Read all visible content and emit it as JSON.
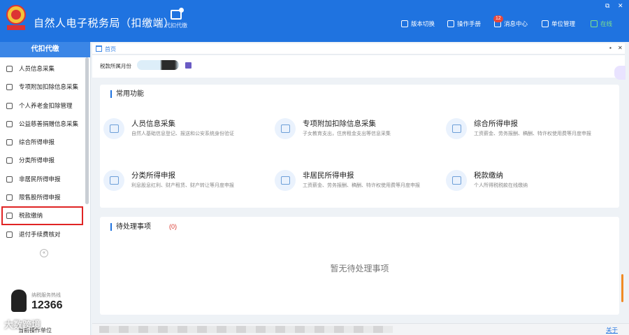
{
  "app": {
    "title": "自然人电子税务局（扣缴端）",
    "emblem_text": "国家税务总局",
    "module_label": "代扣代缴"
  },
  "topmenu": [
    {
      "label": "版本切换",
      "icon": "switch-icon"
    },
    {
      "label": "操作手册",
      "icon": "manual-icon"
    },
    {
      "label": "消息中心",
      "icon": "message-icon",
      "badge": "12"
    },
    {
      "label": "单位管理",
      "icon": "org-icon"
    },
    {
      "label": "在线",
      "icon": "online-icon"
    }
  ],
  "window_controls": {
    "restore": "⧉",
    "close": "✕"
  },
  "sidebar": {
    "header": "代扣代缴",
    "items": [
      {
        "label": "人员信息采集",
        "icon": "person-icon"
      },
      {
        "label": "专项附加扣除信息采集",
        "icon": "grid-icon"
      },
      {
        "label": "个人养老金扣除管理",
        "icon": "pension-icon"
      },
      {
        "label": "公益慈善捐赠信息采集",
        "icon": "donation-icon"
      },
      {
        "label": "综合所得申报",
        "icon": "layers-icon"
      },
      {
        "label": "分类所得申报",
        "icon": "pie-icon"
      },
      {
        "label": "非居民所得申报",
        "icon": "users-icon"
      },
      {
        "label": "限售股所得申报",
        "icon": "bar-chart-icon"
      },
      {
        "label": "税款缴纳",
        "icon": "folder-icon",
        "selected": true
      },
      {
        "label": "退付手续费核对",
        "icon": "checklist-icon"
      }
    ],
    "collapse_symbol": "«",
    "hotline_label": "纳税服务热线",
    "hotline_number": "12366",
    "footer": "当前操作单位"
  },
  "breadcrumb": {
    "home": "首页",
    "ctl_restore": "▪",
    "ctl_close": "✕"
  },
  "period": {
    "label": "税款所属月份"
  },
  "common": {
    "title": "常用功能",
    "functions": [
      {
        "title": "人员信息采集",
        "desc": "自然人基础信息登记、报送和公安系统身份验证",
        "icon": "id-card-icon"
      },
      {
        "title": "专项附加扣除信息采集",
        "desc": "子女教育支出，住房租金支出等信息采集",
        "icon": "deduction-icon"
      },
      {
        "title": "综合所得申报",
        "desc": "工资薪金、劳务报酬、稿酬、特许权使用费等月度申报",
        "icon": "report-icon"
      },
      {
        "title": "分类所得申报",
        "desc": "利息股息红利、财产租赁、财产转让等月度申报",
        "icon": "edit-icon"
      },
      {
        "title": "非居民所得申报",
        "desc": "工资薪金、劳务报酬、稿酬、特许权使用费等月度申报",
        "icon": "edit-icon"
      },
      {
        "title": "税款缴纳",
        "desc": "个人所得税税款在线缴纳",
        "icon": "payment-icon"
      }
    ]
  },
  "pending": {
    "title": "待处理事项",
    "count": "(0)",
    "empty": "暂无待处理事项"
  },
  "status": {
    "about": "关于"
  },
  "watermark": "大数跨境",
  "colors": {
    "primary": "#1f73e0",
    "highlight": "#e02424",
    "count": "#d9342b"
  }
}
